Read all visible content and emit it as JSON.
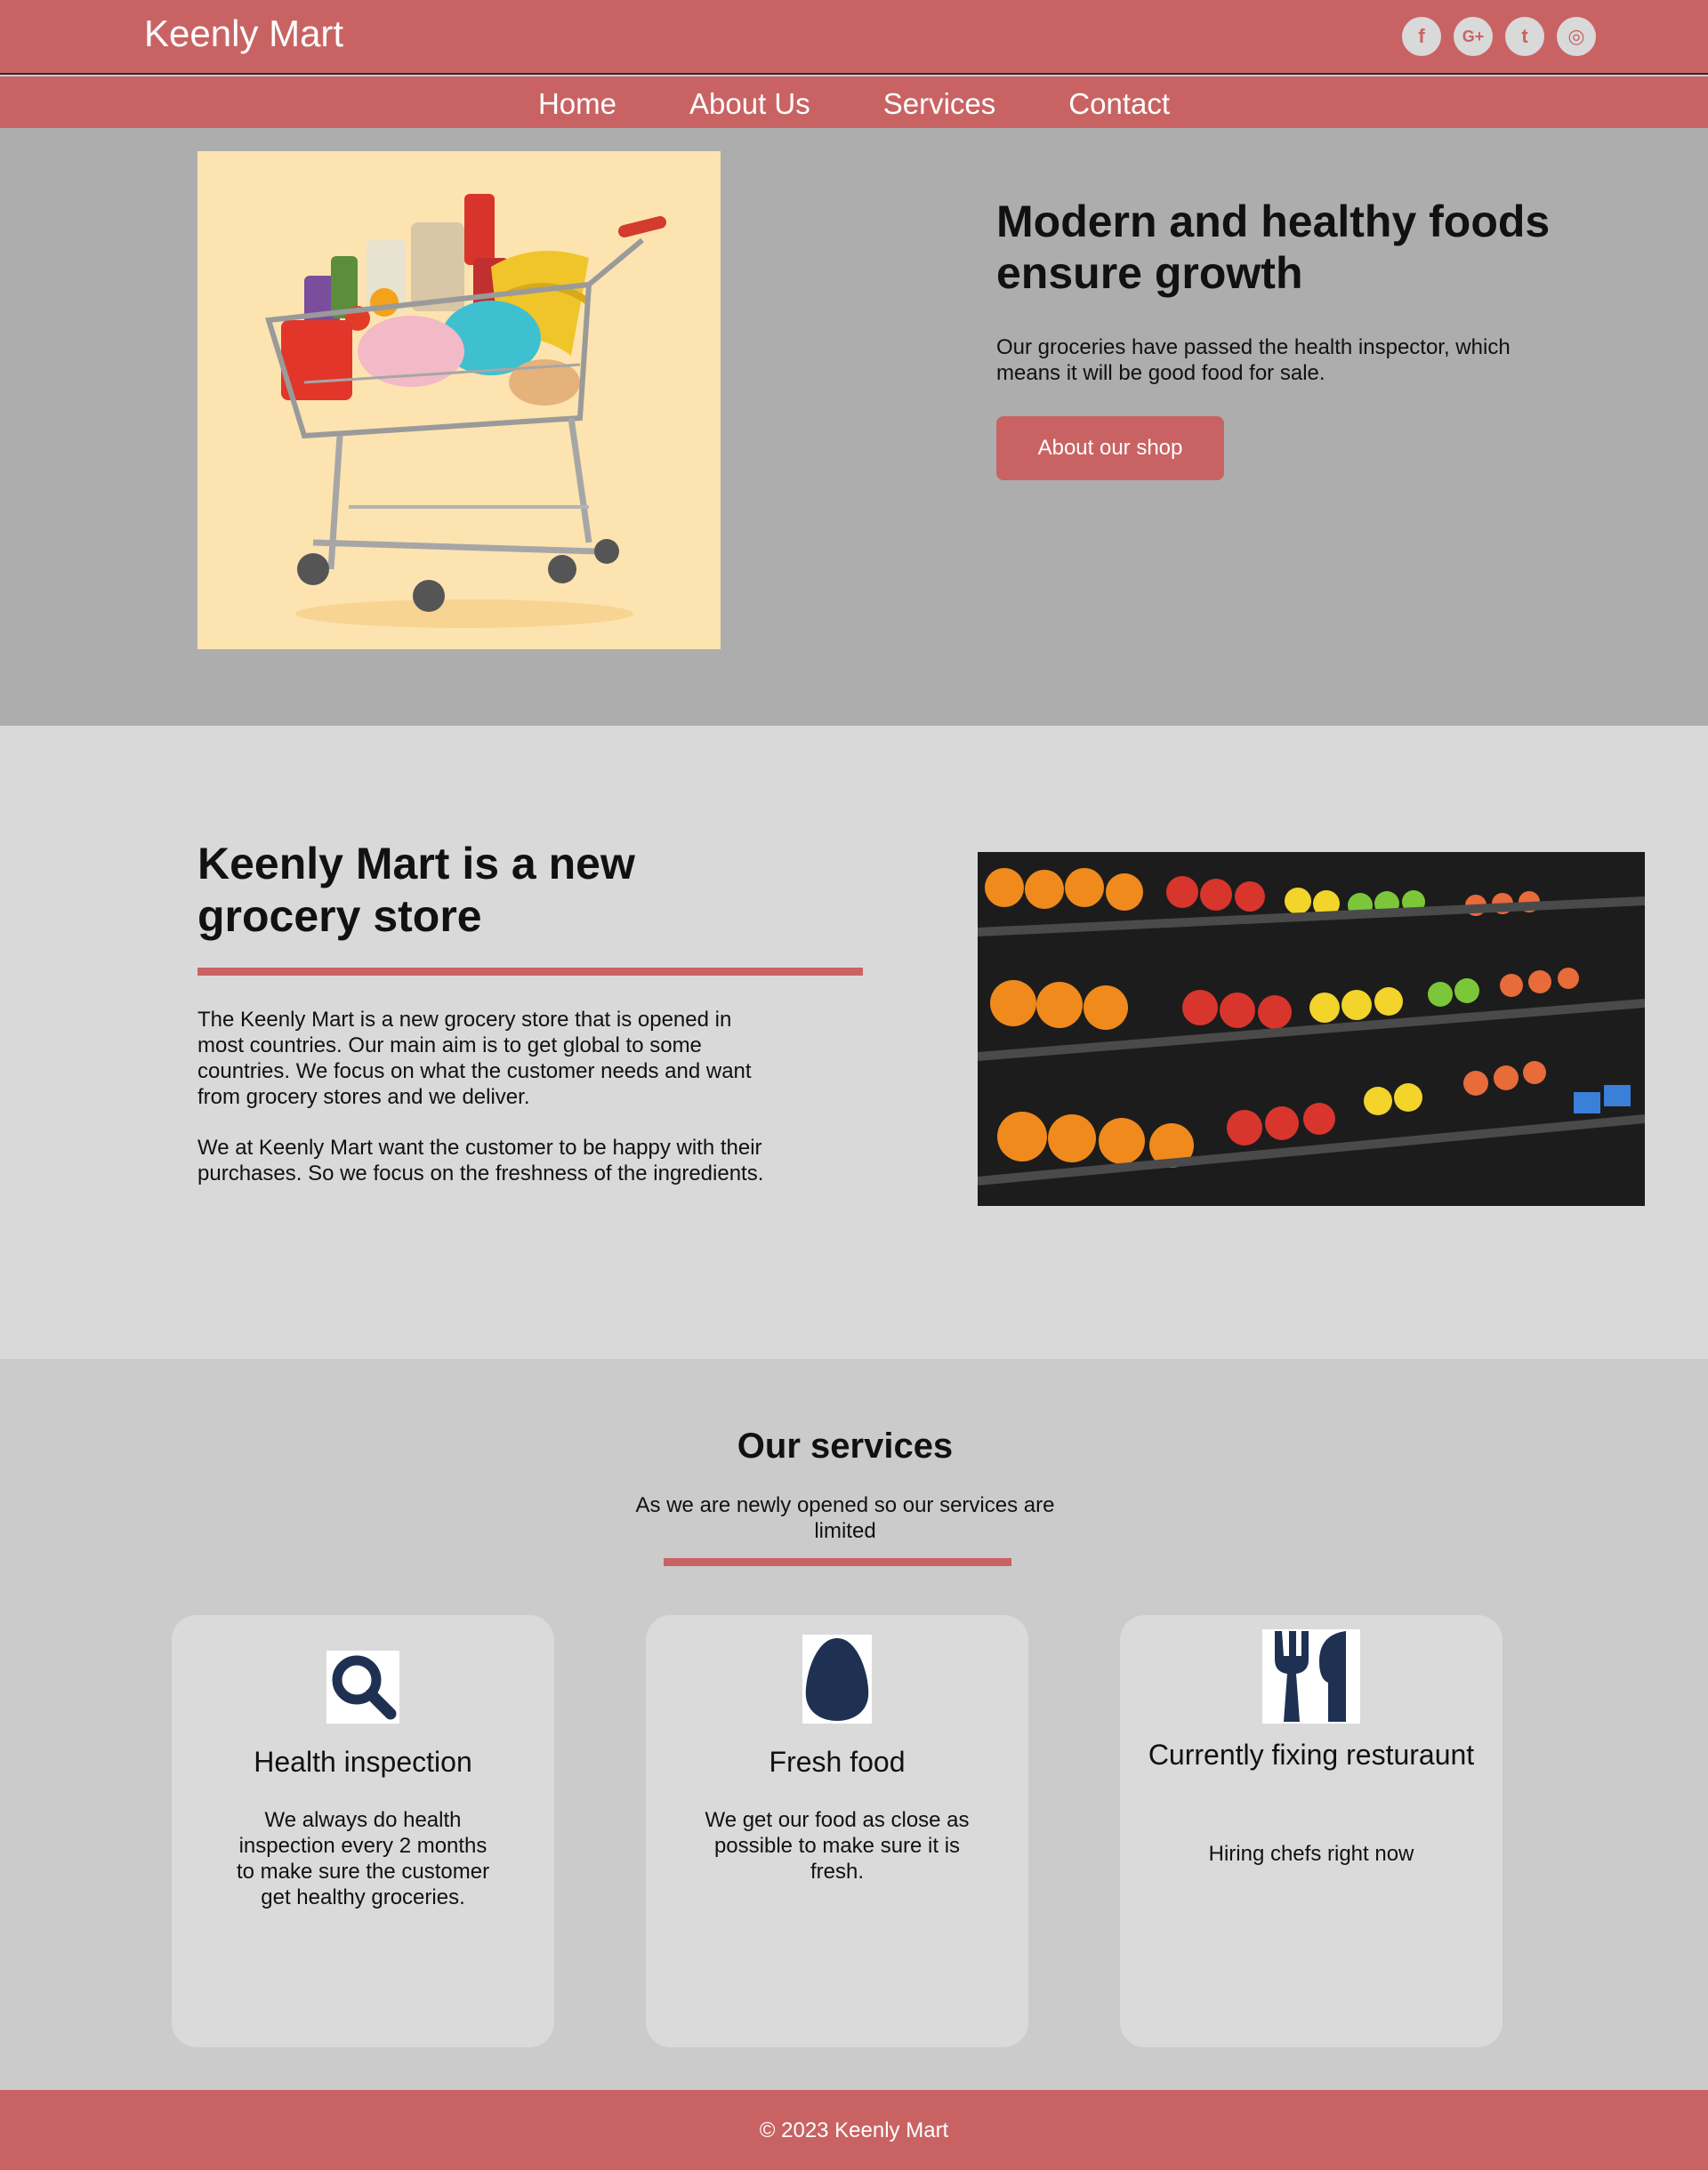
{
  "header": {
    "brand": "Keenly Mart"
  },
  "social": [
    {
      "icon": "facebook-icon",
      "glyph": "f"
    },
    {
      "icon": "google-plus-icon",
      "glyph": "G+"
    },
    {
      "icon": "twitter-icon",
      "glyph": "t"
    },
    {
      "icon": "instagram-icon",
      "glyph": "◎"
    }
  ],
  "nav": {
    "home": "Home",
    "about": "About Us",
    "services": "Services",
    "contact": "Contact"
  },
  "hero": {
    "title": "Modern and healthy foods ensure growth",
    "text": "Our groceries have passed the health inspector, which means it will be good food for sale.",
    "button": "About our shop"
  },
  "about": {
    "title": "Keenly Mart is a new grocery store",
    "p1": "The Keenly Mart is a new grocery store that is opened in most countries. Our main aim is to get global to some countries. We focus on what the customer needs and want from grocery stores and we deliver.",
    "p2": "We at Keenly Mart want the customer to be happy with their purchases. So we focus on the freshness of the ingredients."
  },
  "services": {
    "title": "Our services",
    "subtitle": "As we are newly opened so our services are limited",
    "cards": [
      {
        "icon": "magnifier-icon",
        "title": "Health inspection",
        "text": "We always do health inspection every 2 months to make sure the customer get healthy groceries."
      },
      {
        "icon": "egg-icon",
        "title": "Fresh food",
        "text": "We get our food as close as possible to make sure it is fresh."
      },
      {
        "icon": "fork-knife-icon",
        "title": "Currently fixing resturaunt",
        "text": "Hiring chefs right now"
      }
    ]
  },
  "footer": {
    "copyright": "© 2023 Keenly Mart"
  },
  "colors": {
    "accent": "#c96363",
    "hero_bg": "#adadad",
    "about_bg": "#d9d9d9",
    "services_bg": "#cbcbcb",
    "icon_navy": "#1f3153"
  }
}
